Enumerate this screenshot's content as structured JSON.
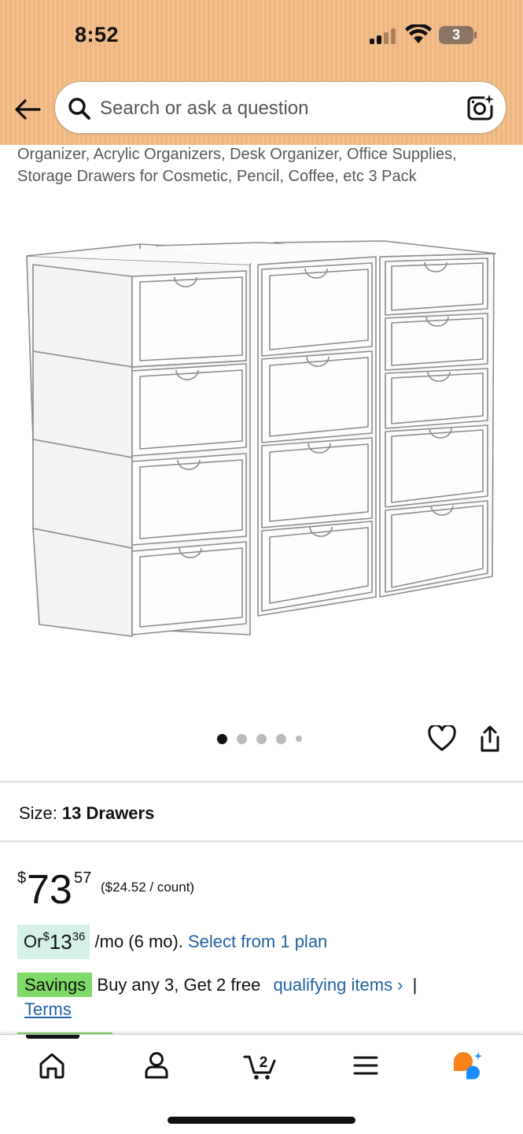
{
  "status_bar": {
    "time": "8:52",
    "battery": "3"
  },
  "search": {
    "placeholder": "Search or ask a question"
  },
  "product": {
    "title": "Organizer, Acrylic Organizers, Desk Organizer, Office Supplies, Storage Drawers for Cosmetic, Pencil, Coffee, etc 3 Pack",
    "image_count": 5,
    "active_image": 1
  },
  "size": {
    "label": "Size:",
    "value": "13 Drawers"
  },
  "price": {
    "symbol": "$",
    "whole": "73",
    "fraction": "57",
    "per_unit": "($24.52 / count)"
  },
  "monthly": {
    "prefix": "Or ",
    "symbol": "$",
    "whole": "13",
    "fraction": "36",
    "suffix": " /mo (6 mo).",
    "link": "Select from 1 plan"
  },
  "savings": {
    "badge": "Savings",
    "text": "Buy any 3, Get 2 free",
    "link": "qualifying items ›",
    "separator": "|",
    "terms": "Terms"
  },
  "bottom_nav": {
    "items": [
      "home-icon",
      "account-icon",
      "cart-icon",
      "menu-icon",
      "rufus-icon"
    ],
    "cart_count": "2"
  },
  "colors": {
    "header_bg": "#f0b987",
    "link": "#2162a1",
    "savings_badge": "#7fda69",
    "monthly_badge": "#d4f1e8",
    "rufus_orange": "#f7821b",
    "rufus_blue": "#1a8cff"
  }
}
